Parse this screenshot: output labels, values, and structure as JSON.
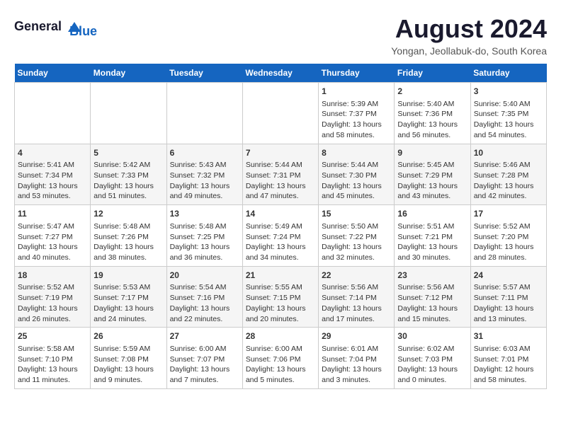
{
  "header": {
    "logo_line1": "General",
    "logo_line2": "Blue",
    "month_title": "August 2024",
    "location": "Yongan, Jeollabuk-do, South Korea"
  },
  "days_of_week": [
    "Sunday",
    "Monday",
    "Tuesday",
    "Wednesday",
    "Thursday",
    "Friday",
    "Saturday"
  ],
  "weeks": [
    [
      {
        "day": "",
        "content": ""
      },
      {
        "day": "",
        "content": ""
      },
      {
        "day": "",
        "content": ""
      },
      {
        "day": "",
        "content": ""
      },
      {
        "day": "1",
        "content": "Sunrise: 5:39 AM\nSunset: 7:37 PM\nDaylight: 13 hours\nand 58 minutes."
      },
      {
        "day": "2",
        "content": "Sunrise: 5:40 AM\nSunset: 7:36 PM\nDaylight: 13 hours\nand 56 minutes."
      },
      {
        "day": "3",
        "content": "Sunrise: 5:40 AM\nSunset: 7:35 PM\nDaylight: 13 hours\nand 54 minutes."
      }
    ],
    [
      {
        "day": "4",
        "content": "Sunrise: 5:41 AM\nSunset: 7:34 PM\nDaylight: 13 hours\nand 53 minutes."
      },
      {
        "day": "5",
        "content": "Sunrise: 5:42 AM\nSunset: 7:33 PM\nDaylight: 13 hours\nand 51 minutes."
      },
      {
        "day": "6",
        "content": "Sunrise: 5:43 AM\nSunset: 7:32 PM\nDaylight: 13 hours\nand 49 minutes."
      },
      {
        "day": "7",
        "content": "Sunrise: 5:44 AM\nSunset: 7:31 PM\nDaylight: 13 hours\nand 47 minutes."
      },
      {
        "day": "8",
        "content": "Sunrise: 5:44 AM\nSunset: 7:30 PM\nDaylight: 13 hours\nand 45 minutes."
      },
      {
        "day": "9",
        "content": "Sunrise: 5:45 AM\nSunset: 7:29 PM\nDaylight: 13 hours\nand 43 minutes."
      },
      {
        "day": "10",
        "content": "Sunrise: 5:46 AM\nSunset: 7:28 PM\nDaylight: 13 hours\nand 42 minutes."
      }
    ],
    [
      {
        "day": "11",
        "content": "Sunrise: 5:47 AM\nSunset: 7:27 PM\nDaylight: 13 hours\nand 40 minutes."
      },
      {
        "day": "12",
        "content": "Sunrise: 5:48 AM\nSunset: 7:26 PM\nDaylight: 13 hours\nand 38 minutes."
      },
      {
        "day": "13",
        "content": "Sunrise: 5:48 AM\nSunset: 7:25 PM\nDaylight: 13 hours\nand 36 minutes."
      },
      {
        "day": "14",
        "content": "Sunrise: 5:49 AM\nSunset: 7:24 PM\nDaylight: 13 hours\nand 34 minutes."
      },
      {
        "day": "15",
        "content": "Sunrise: 5:50 AM\nSunset: 7:22 PM\nDaylight: 13 hours\nand 32 minutes."
      },
      {
        "day": "16",
        "content": "Sunrise: 5:51 AM\nSunset: 7:21 PM\nDaylight: 13 hours\nand 30 minutes."
      },
      {
        "day": "17",
        "content": "Sunrise: 5:52 AM\nSunset: 7:20 PM\nDaylight: 13 hours\nand 28 minutes."
      }
    ],
    [
      {
        "day": "18",
        "content": "Sunrise: 5:52 AM\nSunset: 7:19 PM\nDaylight: 13 hours\nand 26 minutes."
      },
      {
        "day": "19",
        "content": "Sunrise: 5:53 AM\nSunset: 7:17 PM\nDaylight: 13 hours\nand 24 minutes."
      },
      {
        "day": "20",
        "content": "Sunrise: 5:54 AM\nSunset: 7:16 PM\nDaylight: 13 hours\nand 22 minutes."
      },
      {
        "day": "21",
        "content": "Sunrise: 5:55 AM\nSunset: 7:15 PM\nDaylight: 13 hours\nand 20 minutes."
      },
      {
        "day": "22",
        "content": "Sunrise: 5:56 AM\nSunset: 7:14 PM\nDaylight: 13 hours\nand 17 minutes."
      },
      {
        "day": "23",
        "content": "Sunrise: 5:56 AM\nSunset: 7:12 PM\nDaylight: 13 hours\nand 15 minutes."
      },
      {
        "day": "24",
        "content": "Sunrise: 5:57 AM\nSunset: 7:11 PM\nDaylight: 13 hours\nand 13 minutes."
      }
    ],
    [
      {
        "day": "25",
        "content": "Sunrise: 5:58 AM\nSunset: 7:10 PM\nDaylight: 13 hours\nand 11 minutes."
      },
      {
        "day": "26",
        "content": "Sunrise: 5:59 AM\nSunset: 7:08 PM\nDaylight: 13 hours\nand 9 minutes."
      },
      {
        "day": "27",
        "content": "Sunrise: 6:00 AM\nSunset: 7:07 PM\nDaylight: 13 hours\nand 7 minutes."
      },
      {
        "day": "28",
        "content": "Sunrise: 6:00 AM\nSunset: 7:06 PM\nDaylight: 13 hours\nand 5 minutes."
      },
      {
        "day": "29",
        "content": "Sunrise: 6:01 AM\nSunset: 7:04 PM\nDaylight: 13 hours\nand 3 minutes."
      },
      {
        "day": "30",
        "content": "Sunrise: 6:02 AM\nSunset: 7:03 PM\nDaylight: 13 hours\nand 0 minutes."
      },
      {
        "day": "31",
        "content": "Sunrise: 6:03 AM\nSunset: 7:01 PM\nDaylight: 12 hours\nand 58 minutes."
      }
    ]
  ]
}
